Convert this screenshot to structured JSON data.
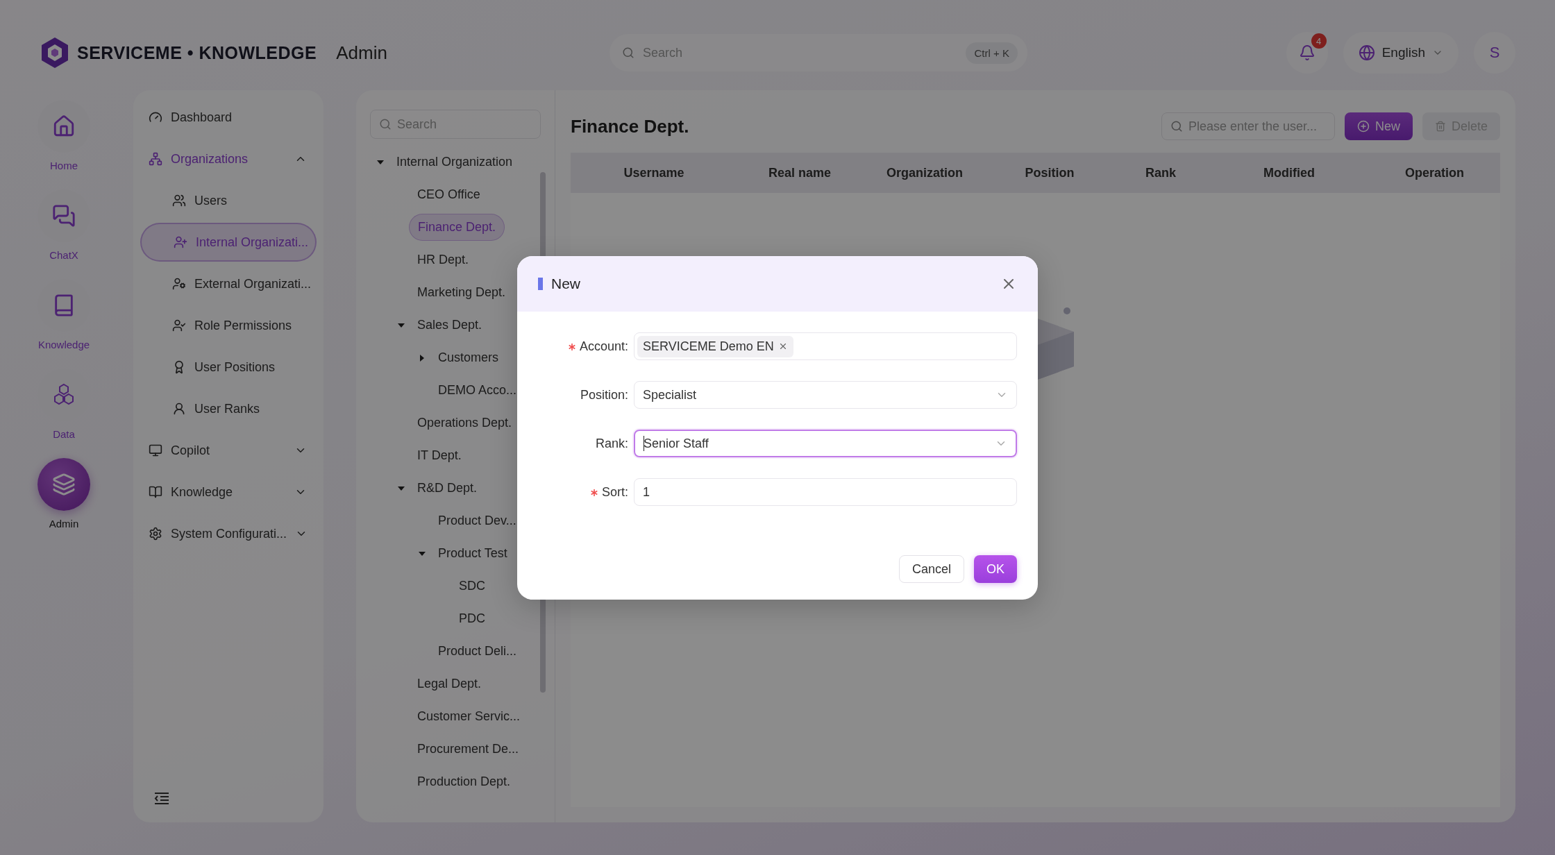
{
  "header": {
    "logo_text": "SERVICEME • KNOWLEDGE",
    "section": "Admin",
    "search": {
      "placeholder": "Search",
      "shortcut": "Ctrl + K"
    },
    "notifications": "4",
    "language": "English",
    "avatar": "S"
  },
  "rail": [
    {
      "label": "Home",
      "selected": false
    },
    {
      "label": "ChatX",
      "selected": false
    },
    {
      "label": "Knowledge",
      "selected": false
    },
    {
      "label": "Data",
      "selected": false
    },
    {
      "label": "Admin",
      "selected": true
    }
  ],
  "menu": [
    {
      "label": "Dashboard",
      "selected": false
    },
    {
      "label": "Organizations",
      "selected": false,
      "expanded": true,
      "children": [
        {
          "label": "Users",
          "selected": false
        },
        {
          "label": "Internal Organizati...",
          "selected": true
        },
        {
          "label": "External Organizati...",
          "selected": false
        },
        {
          "label": "Role Permissions",
          "selected": false
        },
        {
          "label": "User Positions",
          "selected": false
        },
        {
          "label": "User Ranks",
          "selected": false
        }
      ]
    },
    {
      "label": "Copilot",
      "selected": false,
      "expanded": false
    },
    {
      "label": "Knowledge",
      "selected": false,
      "expanded": false
    },
    {
      "label": "System Configurati...",
      "selected": false,
      "expanded": false
    }
  ],
  "tree": {
    "search": {
      "placeholder": "Search"
    },
    "items": [
      {
        "label": "Internal Organization",
        "selected": false,
        "expanded": true,
        "children": [
          {
            "label": "CEO Office",
            "selected": false
          },
          {
            "label": "Finance Dept.",
            "selected": true
          },
          {
            "label": "HR Dept.",
            "selected": false
          },
          {
            "label": "Marketing Dept.",
            "selected": false
          },
          {
            "label": "Sales Dept.",
            "selected": false,
            "expanded": true,
            "children": [
              {
                "label": "Customers",
                "selected": false,
                "expanded": false
              },
              {
                "label": "DEMO Acco...",
                "selected": false
              }
            ]
          },
          {
            "label": "Operations Dept.",
            "selected": false
          },
          {
            "label": "IT Dept.",
            "selected": false
          },
          {
            "label": "R&D Dept.",
            "selected": false,
            "expanded": true,
            "children": [
              {
                "label": "Product Dev...",
                "selected": false
              },
              {
                "label": "Product Test",
                "selected": false,
                "expanded": true,
                "children": [
                  {
                    "label": "SDC",
                    "selected": false
                  },
                  {
                    "label": "PDC",
                    "selected": false
                  }
                ]
              },
              {
                "label": "Product Deli...",
                "selected": false
              }
            ]
          },
          {
            "label": "Legal Dept.",
            "selected": false
          },
          {
            "label": "Customer Servic...",
            "selected": false
          },
          {
            "label": "Procurement De...",
            "selected": false
          },
          {
            "label": "Production Dept.",
            "selected": false
          }
        ]
      }
    ]
  },
  "content": {
    "title": "Finance Dept.",
    "search": {
      "placeholder": "Please enter the user..."
    },
    "new_button": {
      "label": "New",
      "disabled": false
    },
    "delete_button": {
      "label": "Delete",
      "disabled": true
    },
    "table": {
      "columns": [
        "Username",
        "Real name",
        "Organization",
        "Position",
        "Rank",
        "Modified",
        "Operation"
      ]
    }
  },
  "modal": {
    "title": "New",
    "fields": [
      {
        "kind": "tags",
        "label": "Account:",
        "required": true,
        "focused": false,
        "tags": [
          "SERVICEME Demo EN"
        ]
      },
      {
        "kind": "select",
        "label": "Position:",
        "required": false,
        "focused": false,
        "value": "Specialist"
      },
      {
        "kind": "select",
        "label": "Rank:",
        "required": false,
        "focused": true,
        "value": "Senior Staff"
      },
      {
        "kind": "text",
        "label": "Sort:",
        "required": true,
        "focused": false,
        "value": "1"
      }
    ],
    "buttons": [
      {
        "kind": "secondary",
        "label": "Cancel"
      },
      {
        "kind": "primary",
        "label": "OK"
      }
    ]
  }
}
